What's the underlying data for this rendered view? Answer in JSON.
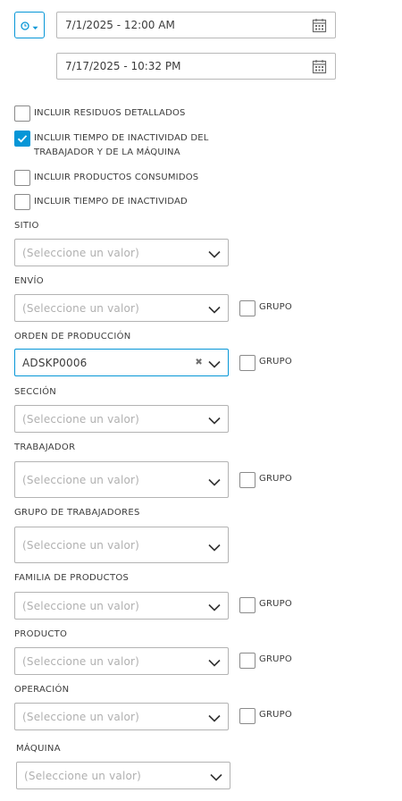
{
  "dates": {
    "start": "7/1/2025 - 12:00 AM",
    "end": "7/17/2025 - 10:32 PM"
  },
  "checkboxes": [
    {
      "line1": "INCLUIR RESIDUOS DETALLADOS",
      "line2": "",
      "checked": false
    },
    {
      "line1": "INCLUIR TIEMPO DE INACTIVIDAD DEL",
      "line2": "TRABAJADOR Y DE LA MÁQUINA",
      "checked": true
    },
    {
      "line1": "INCLUIR PRODUCTOS CONSUMIDOS",
      "line2": "",
      "checked": false
    },
    {
      "line1": "INCLUIR TIEMPO DE INACTIVIDAD",
      "line2": "",
      "checked": false
    }
  ],
  "placeholder": "(Seleccione un valor)",
  "group_label": "GRUPO",
  "fields": {
    "sitio": {
      "label": "SITIO"
    },
    "envio": {
      "label": "ENVÍO"
    },
    "orden": {
      "label": "ORDEN DE PRODUCCIÓN",
      "value": "ADSKP0006"
    },
    "seccion": {
      "label": "SECCIÓN"
    },
    "trabajador": {
      "label": "TRABAJADOR"
    },
    "grupo_trabajadores": {
      "label": "GRUPO DE TRABAJADORES"
    },
    "familia": {
      "label": "FAMILIA DE PRODUCTOS"
    },
    "producto": {
      "label": "PRODUCTO"
    },
    "operacion": {
      "label": "OPERACIÓN"
    },
    "maquina": {
      "label": "MÁQUINA"
    }
  },
  "colors": {
    "accent": "#0696d7",
    "border": "#b3b3b3",
    "placeholder": "#b0b0b0"
  }
}
